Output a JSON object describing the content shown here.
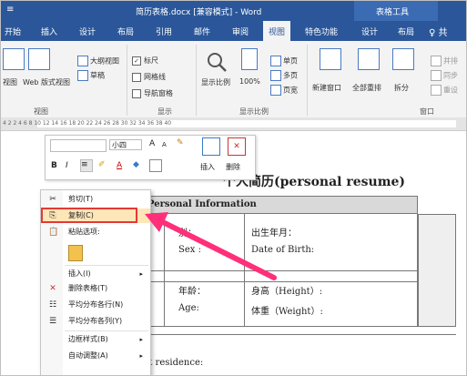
{
  "window": {
    "qat_symbol": "≡",
    "title": "简历表格.docx [兼容模式] - Word",
    "tools_label": "表格工具",
    "right_symbol": "♀ 共"
  },
  "tabs": [
    {
      "label": "开始"
    },
    {
      "label": "插入"
    },
    {
      "label": "设计"
    },
    {
      "label": "布局"
    },
    {
      "label": "引用"
    },
    {
      "label": "邮件"
    },
    {
      "label": "审阅"
    },
    {
      "label": "视图"
    },
    {
      "label": "特色功能"
    },
    {
      "label": "设计"
    },
    {
      "label": "布局"
    }
  ],
  "active_tab": "视图",
  "ribbon": {
    "views": {
      "read_mode": "视图",
      "web_layout": "Web 版式视图",
      "outline": "大纲视图",
      "draft": "草稿",
      "group_label": "视图"
    },
    "show": {
      "ruler": "标尺",
      "gridlines": "网格线",
      "nav_pane": "导航窗格",
      "ruler_checked": "✓",
      "group_label": "显示"
    },
    "zoom": {
      "zoom_btn": "显示比例",
      "hundred": "100%",
      "one_page": "单页",
      "multi_page": "多页",
      "page_width": "页宽",
      "group_label": "显示比例"
    },
    "window": {
      "new_window": "新建窗口",
      "arrange_all": "全部重排",
      "split": "拆分",
      "side_by_side": "并排",
      "sync_scroll": "同步",
      "reset": "重设",
      "group_label": "窗口"
    }
  },
  "ruler_marks": "4  2     2  4  6  8  10  12  14  16  18  20  22  24  26  28  30  32  34  36  38  40",
  "mini_toolbar": {
    "font_size": "小四",
    "grow": "A",
    "shrink": "A",
    "bold": "B",
    "italic": "I",
    "font_color": "A",
    "insert": "插入",
    "delete": "删除"
  },
  "document": {
    "title": "个人简历(personal resume)",
    "section_header": "Personal   Information",
    "r1c1_cn": "别：",
    "r1c1_en": "Sex :",
    "r1c2_cn": "出生年月：",
    "r1c2_en": "Date of Birth:",
    "r2c1_cn": "年龄：",
    "r2c1_en": "Age:",
    "r2c2_cn": "身高（Height）:",
    "r2c2_en": "体重（Weight）:",
    "residence": "ent residence:"
  },
  "context_menu": {
    "cut": "剪切(T)",
    "copy": "复制(C)",
    "paste_options": "粘贴选项:",
    "insert": "插入(I)",
    "delete_table": "删除表格(T)",
    "distribute_rows": "平均分布各行(N)",
    "distribute_cols": "平均分布各列(Y)",
    "border_styles": "边框样式(B)",
    "autofit": "自动调整(A)",
    "arrow": "▸"
  },
  "colors": {
    "title_bar": "#2b579a",
    "highlight": "#fde6b7",
    "callout": "#e53935",
    "arrow": "#ff2f7a"
  }
}
